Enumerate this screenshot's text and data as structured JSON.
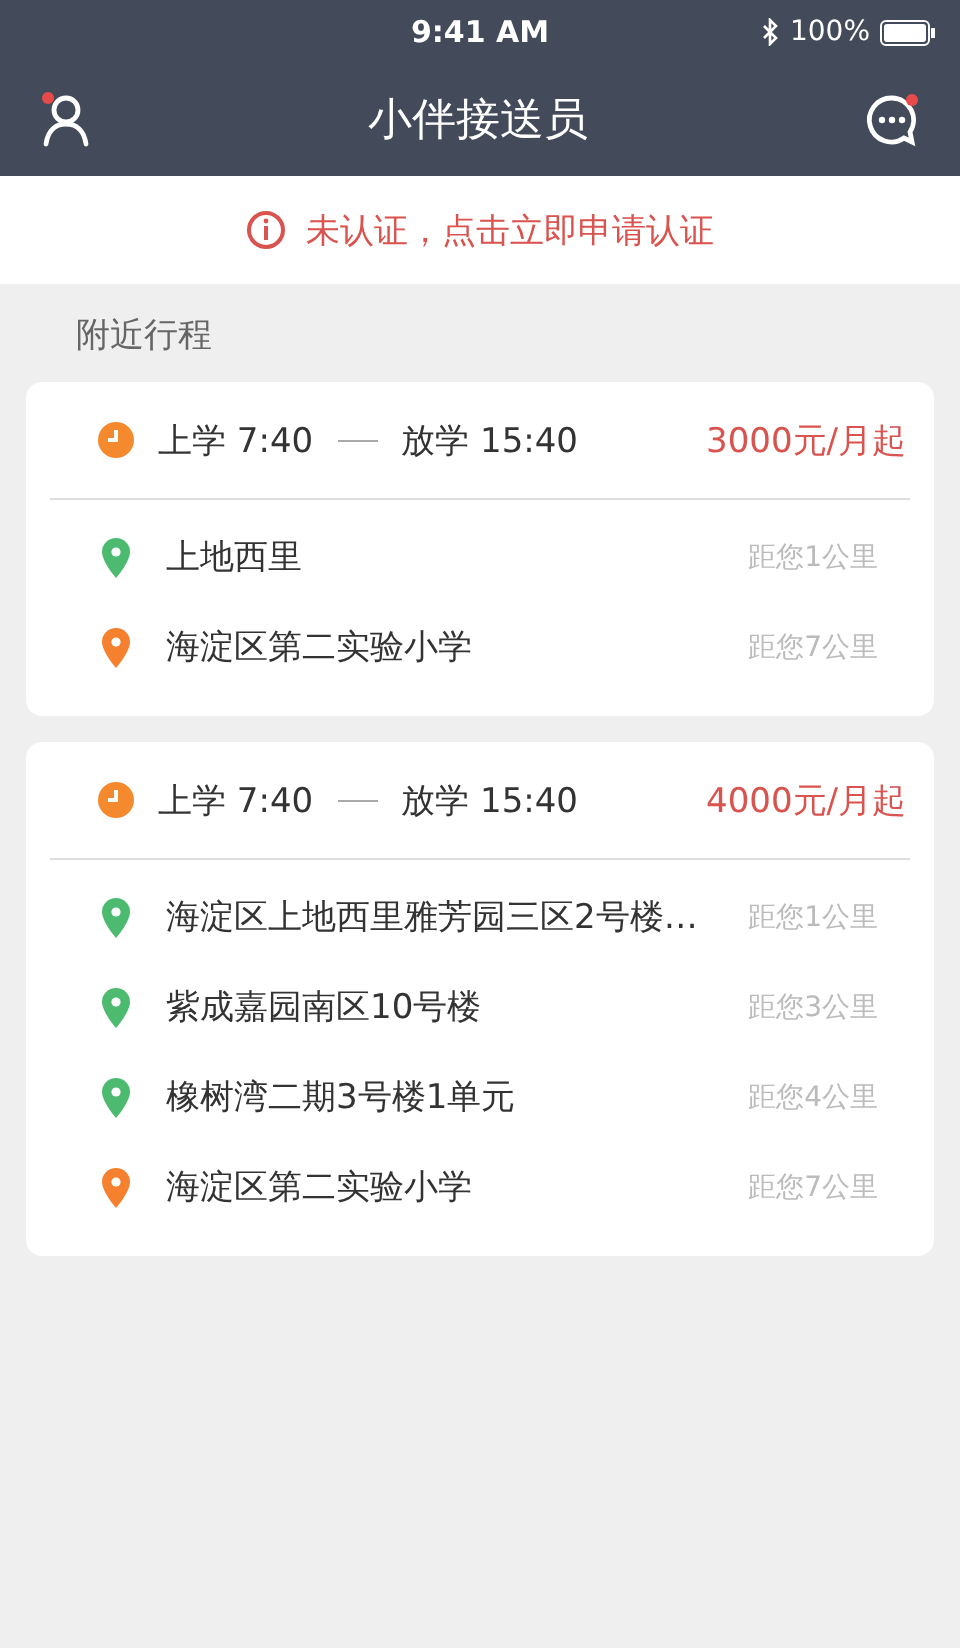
{
  "status_bar": {
    "time": "9:41 AM",
    "battery": "100%"
  },
  "nav_bar": {
    "title": "小伴接送员",
    "profile_badge": true,
    "message_badge": true
  },
  "notice": {
    "text": "未认证，点击立即申请认证"
  },
  "section_title": "附近行程",
  "trips": [
    {
      "pickup": "上学 7:40",
      "dropoff": "放学 15:40",
      "price": "3000元/月起",
      "stops": [
        {
          "name": "上地西里",
          "distance": "距您1公里",
          "color": "#4dbb6f"
        },
        {
          "name": "海淀区第二实验小学",
          "distance": "距您7公里",
          "color": "#f5802e"
        }
      ]
    },
    {
      "pickup": "上学 7:40",
      "dropoff": "放学 15:40",
      "price": "4000元/月起",
      "stops": [
        {
          "name": "海淀区上地西里雅芳园三区2号楼…",
          "distance": "距您1公里",
          "color": "#4dbb6f"
        },
        {
          "name": "紫成嘉园南区10号楼",
          "distance": "距您3公里",
          "color": "#4dbb6f"
        },
        {
          "name": "橡树湾二期3号楼1单元",
          "distance": "距您4公里",
          "color": "#4dbb6f"
        },
        {
          "name": "海淀区第二实验小学",
          "distance": "距您7公里",
          "color": "#f5802e"
        }
      ]
    }
  ]
}
